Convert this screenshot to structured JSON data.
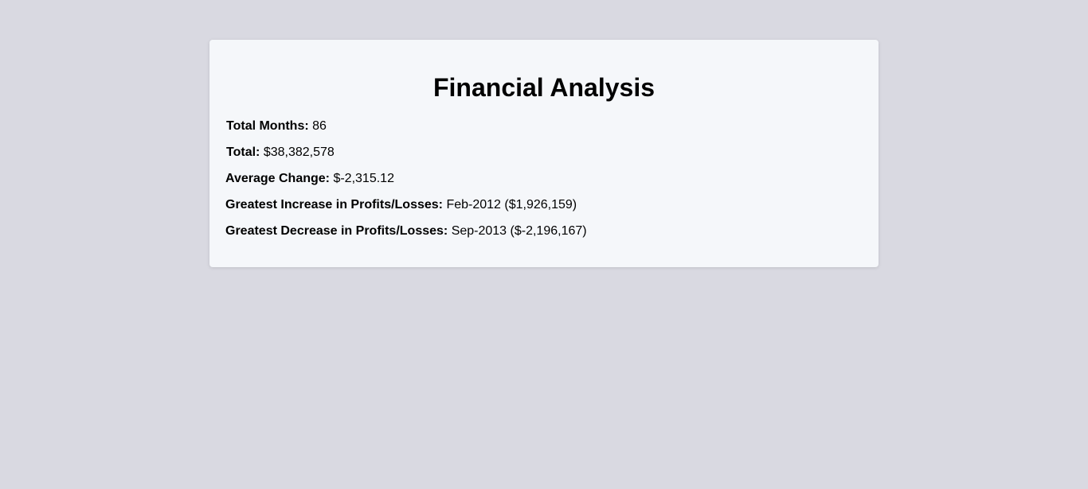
{
  "title": "Financial Analysis",
  "rows": [
    {
      "label": "Total Months:",
      "value": "86"
    },
    {
      "label": "Total:",
      "value": "$38,382,578"
    },
    {
      "label": "Average Change:",
      "value": "$-2,315.12"
    },
    {
      "label": "Greatest Increase in Profits/Losses:",
      "value": "Feb-2012 ($1,926,159)"
    },
    {
      "label": "Greatest Decrease in Profits/Losses:",
      "value": "Sep-2013 ($-2,196,167)"
    }
  ],
  "colors": {
    "page_background": "#d9d9e1",
    "card_background": "#f5f7fa",
    "text": "#000000"
  }
}
